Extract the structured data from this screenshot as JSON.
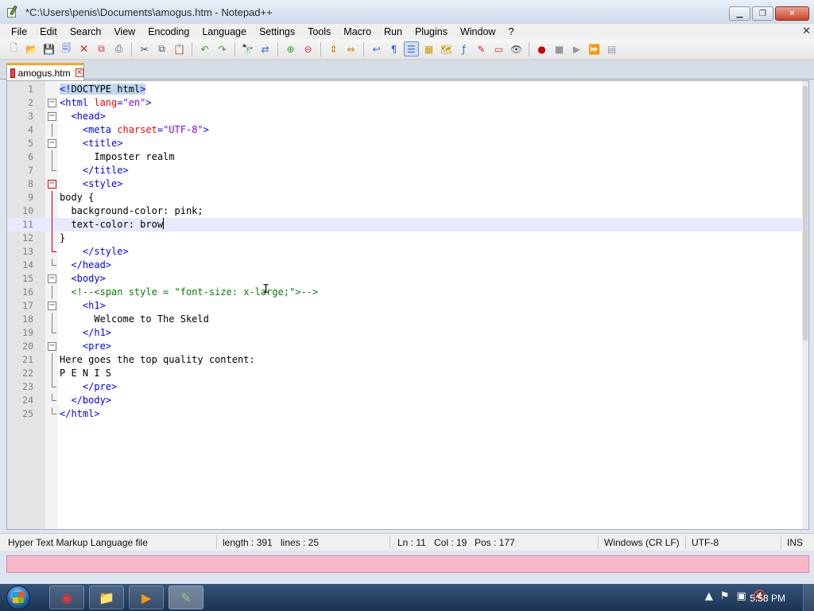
{
  "window": {
    "title": "*C:\\Users\\penis\\Documents\\amogus.htm - Notepad++",
    "minimize": "▁",
    "maximize": "❐",
    "close": "✕"
  },
  "menu": {
    "items": [
      "File",
      "Edit",
      "Search",
      "View",
      "Encoding",
      "Language",
      "Settings",
      "Tools",
      "Macro",
      "Run",
      "Plugins",
      "Window",
      "?"
    ],
    "close_glyph": "✕"
  },
  "tab": {
    "label": "amogus.htm",
    "close_glyph": "✕"
  },
  "editor": {
    "line_numbers": [
      "1",
      "2",
      "3",
      "4",
      "5",
      "6",
      "7",
      "8",
      "9",
      "10",
      "11",
      "12",
      "13",
      "14",
      "15",
      "16",
      "17",
      "18",
      "19",
      "20",
      "21",
      "22",
      "23",
      "24",
      "25"
    ],
    "current_line": 11,
    "lines": [
      "<!DOCTYPE html>",
      "<html lang=\"en\">",
      "  <head>",
      "    <meta charset=\"UTF-8\">",
      "    <title>",
      "      Imposter realm",
      "    </title>",
      "    <style>",
      "body {",
      "  background-color: pink;",
      "  text-color: brow",
      "}",
      "    </style>",
      "  </head>",
      "  <body>",
      "  <!--<span style = \"font-size: x-large;\">-->",
      "    <h1>",
      "      Welcome to The Skeld",
      "    </h1>",
      "    <pre>",
      "Here goes the top quality content:",
      "P E N I S",
      "    </pre>",
      "  </body>",
      "</html>"
    ]
  },
  "status": {
    "file_type": "Hyper Text Markup Language file",
    "length": "length : 391",
    "lines": "lines : 25",
    "ln": "Ln : 11",
    "col": "Col : 19",
    "pos": "Pos : 177",
    "eol": "Windows (CR LF)",
    "encoding": "UTF-8",
    "mode": "INS"
  },
  "taskbar": {
    "clock": "5:58 PM"
  },
  "colors": {
    "tag": "#0000ff",
    "attribute": "#ff0000",
    "string": "#8000ff",
    "comment": "#008000",
    "current_line": "#e8e8ff",
    "pink_bar": "#f7b8c8"
  },
  "icons": {
    "toolbar": [
      "new-file-icon",
      "open-file-icon",
      "save-icon",
      "save-all-icon",
      "close-icon",
      "close-all-icon",
      "print-icon",
      "cut-icon",
      "copy-icon",
      "paste-icon",
      "undo-icon",
      "redo-icon",
      "find-icon",
      "replace-icon",
      "zoom-in-icon",
      "zoom-out-icon",
      "sync-v-icon",
      "sync-h-icon",
      "word-wrap-icon",
      "show-all-chars-icon",
      "indent-guide-icon",
      "udl-icon",
      "doc-map-icon",
      "function-list-icon",
      "folder-workspace-icon",
      "monitor-icon",
      "record-macro-icon",
      "stop-macro-icon",
      "play-macro-icon",
      "run-macro-multiple-icon",
      "save-macro-icon"
    ]
  }
}
